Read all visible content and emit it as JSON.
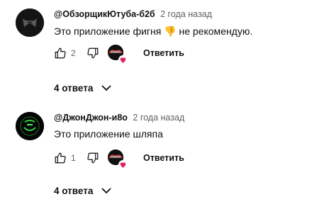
{
  "comments": [
    {
      "author": "@ОбзорщикЮтуба-б2б",
      "time": "2 года назад",
      "text": "Это приложение фигня 👎 не рекомендую.",
      "likes": "2",
      "reply_label": "Ответить",
      "replies_label": "4 ответа",
      "avatar_icon": "dark-logo-avatar"
    },
    {
      "author": "@ДжонДжон-и8о",
      "time": "2 года назад",
      "text": "Это приложение шляпа",
      "likes": "1",
      "reply_label": "Ответить",
      "replies_label": "4 ответа",
      "avatar_icon": "green-logo-avatar"
    }
  ],
  "colors": {
    "text": "#0f0f0f",
    "secondary": "#606060",
    "heart": "#e0245e",
    "background": "#ffffff"
  }
}
